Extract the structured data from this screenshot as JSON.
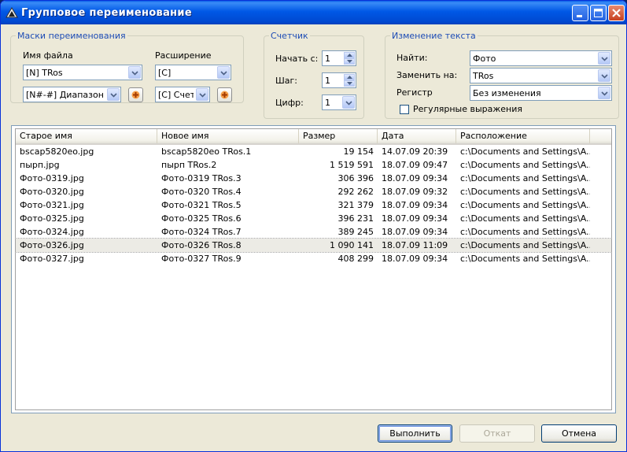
{
  "window": {
    "title": "Групповое переименование"
  },
  "masks": {
    "legend": "Маски переименования",
    "filename_label": "Имя файла",
    "filename_value": "[N] TRos",
    "range_value": "[N#-#] Диапазон",
    "extension_label": "Расширение",
    "extension_value": "[C]",
    "counter_value": "[C] Счетчи"
  },
  "counter": {
    "legend": "Счетчик",
    "start_label": "Начать с:",
    "start_value": "1",
    "step_label": "Шаг:",
    "step_value": "1",
    "digits_label": "Цифр:",
    "digits_value": "1"
  },
  "text_change": {
    "legend": "Изменение текста",
    "find_label": "Найти:",
    "find_value": "Фото",
    "replace_label": "Заменить на:",
    "replace_value": "TRos",
    "case_label": "Регистр",
    "case_value": "Без изменения",
    "regex_label": "Регулярные выражения"
  },
  "table": {
    "columns": [
      "Старое имя",
      "Новое имя",
      "Размер",
      "Дата",
      "Расположение"
    ],
    "rows": [
      [
        "bscap5820eo.jpg",
        "bscap5820eo TRos.1",
        "19 154",
        "14.07.09 20:39",
        "c:\\Documents and Settings\\A.."
      ],
      [
        "пырп.jpg",
        "пырп TRos.2",
        "1 519 591",
        "18.07.09 09:47",
        "c:\\Documents and Settings\\A.."
      ],
      [
        "Фото-0319.jpg",
        "Фото-0319 TRos.3",
        "306 396",
        "18.07.09 09:34",
        "c:\\Documents and Settings\\A.."
      ],
      [
        "Фото-0320.jpg",
        "Фото-0320 TRos.4",
        "292 262",
        "18.07.09 09:32",
        "c:\\Documents and Settings\\A.."
      ],
      [
        "Фото-0321.jpg",
        "Фото-0321 TRos.5",
        "321 379",
        "18.07.09 09:34",
        "c:\\Documents and Settings\\A.."
      ],
      [
        "Фото-0325.jpg",
        "Фото-0325 TRos.6",
        "396 231",
        "18.07.09 09:34",
        "c:\\Documents and Settings\\A.."
      ],
      [
        "Фото-0324.jpg",
        "Фото-0324 TRos.7",
        "389 245",
        "18.07.09 09:34",
        "c:\\Documents and Settings\\A.."
      ],
      [
        "Фото-0326.jpg",
        "Фото-0326 TRos.8",
        "1 090 141",
        "18.07.09 11:09",
        "c:\\Documents and Settings\\A.."
      ],
      [
        "Фото-0327.jpg",
        "Фото-0327 TRos.9",
        "408 299",
        "18.07.09 09:34",
        "c:\\Documents and Settings\\A.."
      ]
    ]
  },
  "buttons": {
    "run": "Выполнить",
    "undo": "Откат",
    "cancel": "Отмена"
  },
  "icons": {
    "app": "app-logo-icon",
    "minimize": "minimize-icon",
    "maximize": "maximize-icon",
    "close": "close-icon",
    "dropdown": "chevron-down-icon",
    "add": "plus-icon"
  },
  "colors": {
    "title_bar": "#0058e6",
    "close": "#c7401f",
    "legend": "#1c4bb5",
    "selected_row": "#ecebe5"
  }
}
